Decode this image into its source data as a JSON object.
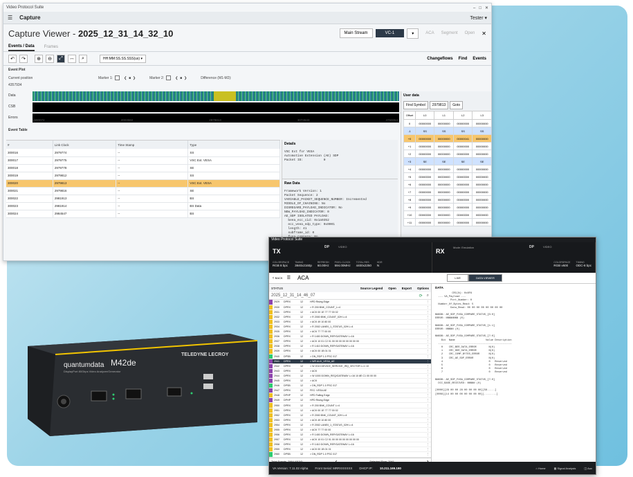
{
  "window1": {
    "app_title": "Video Protocol Suite",
    "menu_title": "Capture",
    "user": "Tester",
    "viewer_title_prefix": "Capture Viewer -",
    "viewer_title_name": "2025_12_31_14_32_10",
    "stream_button": "Main Stream",
    "stream_selected": "VC-1",
    "right_links": [
      "ACA",
      "Segment",
      "Open"
    ],
    "tabs": [
      "Events / Data",
      "Frames"
    ],
    "dropdown_value": "HH:MM:SS.SS.SSS(us)",
    "tool_right": [
      "Changeflows",
      "Find",
      "Events"
    ],
    "event_plot_label": "Event Plot",
    "current_position_label": "Current position",
    "current_position_value": "4357934",
    "marker1_label": "Marker 1:",
    "marker2_label": "Marker 2:",
    "difference_label": "Difference (M1-M2):",
    "plot_labels": [
      "Data",
      "CSB",
      "Errors"
    ],
    "axis_ticks": [
      "1590072",
      "2003582",
      "2979813",
      "3074533",
      "4760054"
    ],
    "event_table_label": "Event Table",
    "columns": [
      "#",
      "Link Clock",
      "Time Stamp",
      "Type"
    ],
    "rows": [
      [
        "300016",
        "2979774",
        "--",
        "SS"
      ],
      [
        "300017",
        "2979775",
        "--",
        "VSC Ext. VESA"
      ],
      [
        "300018",
        "2979778",
        "--",
        "SE"
      ],
      [
        "300019",
        "2979812",
        "--",
        "SS"
      ],
      [
        "300020",
        "2979813",
        "--",
        "VSC Ext. VESA"
      ],
      [
        "300021",
        "2979816",
        "--",
        "SE"
      ],
      [
        "300022",
        "2981913",
        "--",
        "BS"
      ],
      [
        "300023",
        "2981914",
        "--",
        "BS Data"
      ],
      [
        "300024",
        "2984547",
        "--",
        "BS"
      ]
    ],
    "highlighted_row": 4,
    "details_label": "Details",
    "details_text": "VSC Ext for VESA\nAutomotive Extension (AE) SDP\nPacket ID:           0",
    "raw_data_label": "Raw Data",
    "raw_text": "Framework Version: 1\nPacket Sequence: 2\nVARIABLE_PACKET_SEQUENCE_NUMBER: Incremented\nMIDDLE_OF_CHAINING: No\nDISREGARD_PAYLOAD_INDICATOR: No\nNEW_PAYLOAD_INDICATOR: 0\nAE_SDP ISOLATED PAYLOAD:\n  beea_ecc_cid: 0x1a9352\n  ecc_veea_edp_type: 0x0001\n  length: 41\n  subframe_id: 0\n  fusa_compare: No\n  frame_id: 44400",
    "user_data": {
      "label": "User data",
      "find_button": "Find Symbol",
      "find_value": "2979813",
      "goto_button": "Goto",
      "headers": [
        "Offset",
        "L0",
        "L1",
        "L2",
        "L3"
      ],
      "rows": [
        [
          "0",
          "00000000",
          "00000000",
          "00000000",
          "00000000"
        ],
        [
          "-1",
          "SS",
          "SS",
          "SS",
          "SS"
        ],
        [
          "+0",
          "00000000",
          "00000000",
          "00000041",
          "00000000"
        ],
        [
          "+1",
          "00000000",
          "00000000",
          "00000000",
          "00000000"
        ],
        [
          "+2",
          "00000000",
          "00000000",
          "00000000",
          "00000000"
        ],
        [
          "+3",
          "SE",
          "SE",
          "SE",
          "SE"
        ],
        [
          "+4",
          "00000000",
          "00000000",
          "00000000",
          "00000000"
        ],
        [
          "+5",
          "00000000",
          "00000000",
          "00000000",
          "00000000"
        ],
        [
          "+6",
          "00000000",
          "00000000",
          "00000000",
          "00000000"
        ],
        [
          "+7",
          "00000000",
          "00000000",
          "00000000",
          "00000000"
        ],
        [
          "+8",
          "00000000",
          "00000000",
          "00000000",
          "00000000"
        ],
        [
          "+9",
          "00000000",
          "00000000",
          "00000000",
          "00000000"
        ],
        [
          "+10",
          "00000000",
          "00000000",
          "00000000",
          "00000000"
        ],
        [
          "+11",
          "00000000",
          "00000000",
          "00000000",
          "00000000"
        ]
      ]
    }
  },
  "device": {
    "brand": "quantumdata",
    "model": "M42de",
    "subtitle": "DisplayPort 80Gbps Video Analyzer/Generator",
    "maker": "TELEDYNE LECROY"
  },
  "window2": {
    "app_title": "Video Protocol Suite",
    "tx_label": "TX",
    "rx_label": "RX",
    "dp_label": "DP",
    "video_label": "VIDEO",
    "tx_stats": [
      [
        "COLORSPACE",
        "RGB 8 bpc"
      ],
      [
        "TIMING",
        "3840x2160p"
      ],
      [
        "REFRESH",
        "60.00Hz"
      ],
      [
        "PIXEL CLOCK",
        "594.00MHz"
      ],
      [
        "TOTAL RES",
        "4400x2250"
      ],
      [
        "HDR",
        "N"
      ]
    ],
    "rx_stats": [
      [
        "COLORSPACE",
        "RGB v600"
      ],
      [
        "TIMING",
        "ODC-8 bpc"
      ]
    ],
    "rx_mode": "Mode: Emulation",
    "nav_back": "BACK",
    "nav_title": "ACA",
    "seg_live": "LIVE",
    "seg_data": "DATA VIEWER",
    "status_label": "STATUS",
    "left_actions": [
      "Source Legend",
      "Open",
      "Export",
      "Options"
    ],
    "capture_name": "2025_12_31_14_46_07",
    "data_label": "DATA",
    "list_rows": [
      [
        "2929",
        "DPRX",
        "12",
        "HPD Rising Edge",
        "#8e44ad"
      ],
      [
        "2930",
        "DPRX",
        "12",
        "> R 200 BNK_COUNT_L=4",
        "#f0c020"
      ],
      [
        "2931",
        "DPRX",
        "12",
        "> ACK 00 1E 77 77 00 02",
        "#f0c020"
      ],
      [
        "2932",
        "DPRX",
        "12",
        "> R 2000 BNK_COUNT_02H L=4",
        "#f0c020"
      ],
      [
        "2933",
        "DPRX",
        "12",
        "> ACK 49 10 80 00",
        "#f0c020"
      ],
      [
        "2934",
        "DPRX",
        "12",
        "> R 2002 LANE0_1_STATUS_02H L=4",
        "#f0c020"
      ],
      [
        "2935",
        "DPRX",
        "12",
        "> ACK 77 77 00 00",
        "#f0c020"
      ],
      [
        "2936",
        "DPRX",
        "12",
        "> R 1400 DOWN_REP/GATEWAY L=16",
        "#f0c020"
      ],
      [
        "2937",
        "DPRX",
        "12",
        "> ACK 10 01 C2 01 00 00 00 00 00 00 00 00",
        "#f0c020"
      ],
      [
        "2938",
        "DPRX",
        "12",
        "> R 1410 DOWN_REP/GATEWAY L=16",
        "#f0c020"
      ],
      [
        "2939",
        "DPRX",
        "12",
        "> ACK 00 1B 01 01",
        "#f0c020"
      ],
      [
        "2940",
        "DPSB",
        "12",
        "> DN_RDP 1.0 PSC 017",
        "#2ecc71"
      ],
      [
        "2941",
        "DPRX",
        "12",
        "> WR AUX_VESA_AE",
        "#8e44ad"
      ],
      [
        "2942",
        "DPRX",
        "12",
        "> W 2013 DEVICE_SERVICE_IRQ_VECTOR L=1 10",
        "#8e44ad"
      ],
      [
        "2943",
        "DPRX",
        "12",
        "> ACK",
        "#8e44ad"
      ],
      [
        "2944",
        "DPRX",
        "12",
        "> W 1000 DOWN_REQ/GATEWAY L=16 10 8E C1 00 00 00",
        "#8e44ad"
      ],
      [
        "2945",
        "DPRX",
        "12",
        "> ACK",
        "#8e44ad"
      ],
      [
        "2946",
        "DPSB",
        "12",
        "> DN_RDP 1.0 PSC 017",
        "#2ecc71"
      ],
      [
        "2947",
        "DPRX",
        "12",
        "FEC: VESA AE",
        "#8e44ad"
      ],
      [
        "2948",
        "DPHP",
        "12",
        "HPD Falling Edge",
        "#f0c020"
      ],
      [
        "2949",
        "DPHP",
        "12",
        "HPD Rising Edge",
        "#8e44ad"
      ],
      [
        "2950",
        "DPRX",
        "12",
        "> R 200 BNK_COUNT L=4",
        "#f0c020"
      ],
      [
        "2951",
        "DPRX",
        "12",
        "> ACK 00 1E 77 77 00 02",
        "#f0c020"
      ],
      [
        "2952",
        "DPRX",
        "12",
        "> R 2000 BNK_COUNT_02H L=4",
        "#f0c020"
      ],
      [
        "2953",
        "DPRX",
        "12",
        "> ACK 49 10 80 00",
        "#f0c020"
      ],
      [
        "2954",
        "DPRX",
        "12",
        "> R 2002 LANE0_1_STATUS_02H L=4",
        "#f0c020"
      ],
      [
        "2955",
        "DPRX",
        "12",
        "> ACK 77 77 00 00",
        "#f0c020"
      ],
      [
        "2956",
        "DPRX",
        "12",
        "> R 1400 DOWN_REP/GATEWAY L=16",
        "#f0c020"
      ],
      [
        "2957",
        "DPRX",
        "12",
        "> ACK 10 01 C2 01 00 00 00 00 00 00 00 00",
        "#f0c020"
      ],
      [
        "2958",
        "DPRX",
        "12",
        "> R 1410 DOWN_REP/GATEWAY L=16",
        "#f0c020"
      ],
      [
        "2959",
        "DPRX",
        "12",
        "> ACK 00 1B 01 01",
        "#f0c020"
      ],
      [
        "2960",
        "DPSB",
        "12",
        "> DN_RDP 1.0 PSC 017",
        "#2ecc71"
      ]
    ],
    "selected_row": 12,
    "footer_total": "Total Events: 2964 (9104)",
    "footer_selected": "Selected Row: 2941",
    "data_text": "           CRC(N): 0x8F6\n  --- VA_Payload ---\n          Port_Number: 0\n  Number_Of_Bytes_Read: 5\n          Data_Read: 00 00 00 00 00 00 00 00\n\nNN8DB: AE_SDP_FUSA_COMPARE_STATUS_[0:0]\nERROR: NNNNNNNN (0)\n\nNN8DB: AE_SDP_FUSA_COMPARE_STATUS_[1:1]\nERROR: NNNNN (0)\n\nNN8DB: AE_SDP_FUSA_COMPARE_STATUS_[7:0]\n    Bit  Name                    Value Description\n  ------------------------------------------------\n    0    CRC_BER_DATA_ERROR        N(0)\n    1    CRC_HDR_DATA_ERROR        N(0)\n    2    CRC_COMP_BYTES_ERROR      N(0)\n    3    CRC_AE_SDP_ERROR          N(0)\n    4                              0   Reserved\n    5                              0   Reserved\n    6                              0   Reserved\n    7                              0   Reserved\n\nNN8DB: AE_SDP_FUSA_COMPARE_STATUS_[7:0]\n  DCC_BASE_RECEIVED: NNNNN (0)\n\n[0000][29 00 00 28 00 00 00 00][58.....]\n[0008][14 00 00 00 00 00 00 00][........]",
    "status_version": "VA Version: 7.11.02 Alpha",
    "status_serial": "Front Serial: MRRXXXXXX",
    "status_ip_label": "DHCP IP:",
    "status_ip": "10.211.169.190",
    "status_icons": [
      "Home",
      "Signal Analysis",
      "Aux"
    ]
  },
  "colors": {
    "accent": "#2d3a48",
    "highlight": "#f7c66d",
    "background": "#9dd4e8"
  }
}
